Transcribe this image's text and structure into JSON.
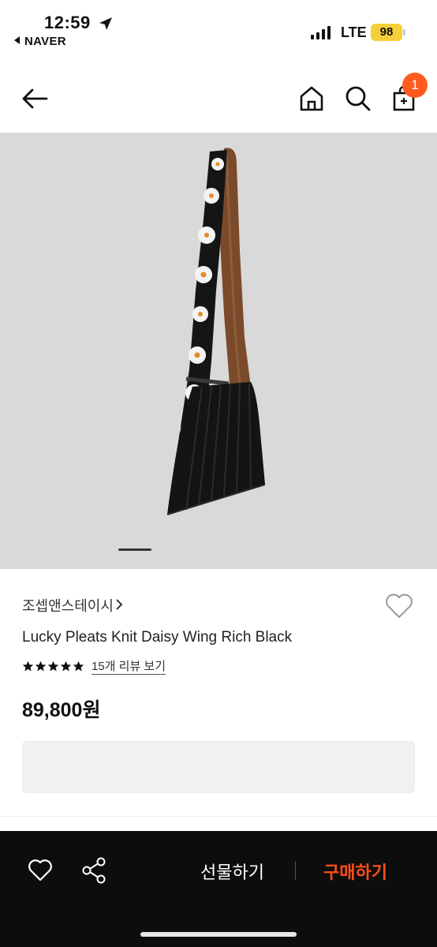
{
  "status_bar": {
    "time": "12:59",
    "back_app": "NAVER",
    "network": "LTE",
    "battery": "98"
  },
  "header": {
    "cart_count": "1"
  },
  "product": {
    "brand": "조셉앤스테이시",
    "title": "Lucky Pleats Knit Daisy Wing Rich Black",
    "rating_stars": 5,
    "review_link": "15개 리뷰 보기",
    "price": "89,800원"
  },
  "gallery": {
    "active_page": 1
  },
  "actions": {
    "gift_label": "선물하기",
    "buy_label": "구매하기"
  },
  "colors": {
    "accent": "#ff4d1a",
    "badge": "#ff5a1f",
    "bottom_bar": "#0d0d0d",
    "battery": "#f5cf3a"
  },
  "icons": [
    "back-arrow-icon",
    "home-icon",
    "search-icon",
    "cart-icon",
    "heart-icon",
    "share-icon",
    "star-icon",
    "chevron-right-icon",
    "location-arrow-icon"
  ]
}
